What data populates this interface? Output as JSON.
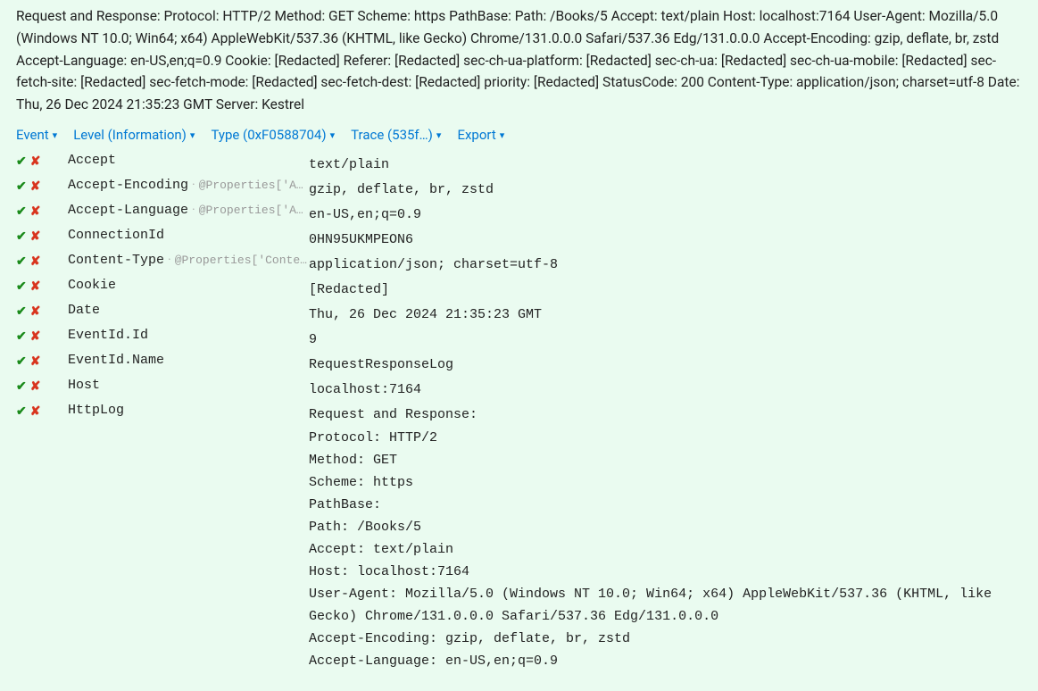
{
  "header_text": "Request and Response: Protocol: HTTP/2 Method: GET Scheme: https PathBase: Path: /Books/5 Accept: text/plain Host: localhost:7164 User-Agent: Mozilla/5.0 (Windows NT 10.0; Win64; x64) AppleWebKit/537.36 (KHTML, like Gecko) Chrome/131.0.0.0 Safari/537.36 Edg/131.0.0.0 Accept-Encoding: gzip, deflate, br, zstd Accept-Language: en-US,en;q=0.9 Cookie: [Redacted] Referer: [Redacted] sec-ch-ua-platform: [Redacted] sec-ch-ua: [Redacted] sec-ch-ua-mobile: [Redacted] sec-fetch-site: [Redacted] sec-fetch-mode: [Redacted] sec-fetch-dest: [Redacted] priority: [Redacted] StatusCode: 200 Content-Type: application/json; charset=utf-8 Date: Thu, 26 Dec 2024 21:35:23 GMT Server: Kestrel",
  "filters": {
    "event": "Event",
    "level": "Level (Information)",
    "type": "Type (0xF0588704)",
    "trace": "Trace (535f…)",
    "export": "Export"
  },
  "props": [
    {
      "name": "Accept",
      "hint": "",
      "value": "text/plain"
    },
    {
      "name": "Accept-Encoding",
      "hint": "@Properties['Ac…",
      "value": "gzip, deflate, br, zstd"
    },
    {
      "name": "Accept-Language",
      "hint": "@Properties['Ac…",
      "value": "en-US,en;q=0.9"
    },
    {
      "name": "ConnectionId",
      "hint": "",
      "value": "0HN95UKMPEON6"
    },
    {
      "name": "Content-Type",
      "hint": "@Properties['Conten…",
      "value": "application/json; charset=utf-8"
    },
    {
      "name": "Cookie",
      "hint": "",
      "value": "[Redacted]"
    },
    {
      "name": "Date",
      "hint": "",
      "value": "Thu, 26 Dec 2024 21:35:23 GMT"
    },
    {
      "name": "EventId.Id",
      "hint": "",
      "value": "9"
    },
    {
      "name": "EventId.Name",
      "hint": "",
      "value": "RequestResponseLog"
    },
    {
      "name": "Host",
      "hint": "",
      "value": "localhost:7164"
    },
    {
      "name": "HttpLog",
      "hint": "",
      "value": "Request and Response:\nProtocol: HTTP/2\nMethod: GET\nScheme: https\nPathBase:\nPath: /Books/5\nAccept: text/plain\nHost: localhost:7164\nUser-Agent: Mozilla/5.0 (Windows NT 10.0; Win64; x64) AppleWebKit/537.36 (KHTML, like Gecko) Chrome/131.0.0.0 Safari/537.36 Edg/131.0.0.0\nAccept-Encoding: gzip, deflate, br, zstd\nAccept-Language: en-US,en;q=0.9"
    }
  ]
}
